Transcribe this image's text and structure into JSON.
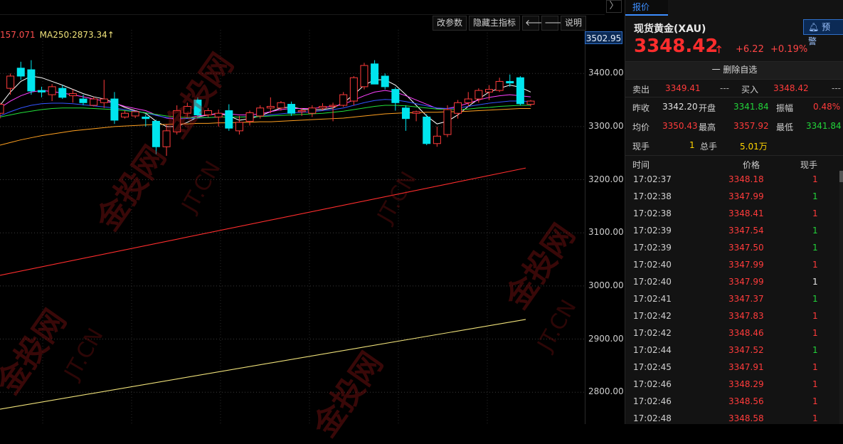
{
  "chart": {
    "toolbar": {
      "params_label": "改参数",
      "hide_indicator_label": "隐藏主指标",
      "prev_label": "🡐",
      "next_label": "🡒",
      "help_label": "说明"
    },
    "panel_toggle": "〉",
    "ma_legend": {
      "ma_partial": "157.071",
      "ma250": "MA250:2873.34↑"
    },
    "price_label_top": "3502.95",
    "y_ticks": [
      "3400.00",
      "3300.00",
      "3200.00",
      "3100.00",
      "3000.00",
      "2900.00",
      "2800.00"
    ],
    "watermark": {
      "brand": "金投网",
      "domain": "JT.CN"
    }
  },
  "chart_data": {
    "type": "candlestick",
    "ylim": [
      2740,
      3482
    ],
    "y_ticks": [
      3400,
      3300,
      3200,
      3100,
      3000,
      2900,
      2800
    ],
    "colors": {
      "up": "#ff3b3b",
      "down": "#00e5ee",
      "ma250": "#f0e27a",
      "ma_long": "#ff2d2d"
    },
    "candles": [
      {
        "o": 3325,
        "h": 3345,
        "l": 3315,
        "c": 3342
      },
      {
        "o": 3372,
        "h": 3400,
        "l": 3360,
        "c": 3395
      },
      {
        "o": 3410,
        "h": 3422,
        "l": 3388,
        "c": 3395
      },
      {
        "o": 3407,
        "h": 3425,
        "l": 3360,
        "c": 3367
      },
      {
        "o": 3368,
        "h": 3375,
        "l": 3355,
        "c": 3365
      },
      {
        "o": 3360,
        "h": 3380,
        "l": 3348,
        "c": 3375
      },
      {
        "o": 3372,
        "h": 3378,
        "l": 3352,
        "c": 3355
      },
      {
        "o": 3358,
        "h": 3370,
        "l": 3345,
        "c": 3362
      },
      {
        "o": 3352,
        "h": 3360,
        "l": 3340,
        "c": 3345
      },
      {
        "o": 3340,
        "h": 3356,
        "l": 3338,
        "c": 3352
      },
      {
        "o": 3345,
        "h": 3388,
        "l": 3335,
        "c": 3352
      },
      {
        "o": 3352,
        "h": 3365,
        "l": 3305,
        "c": 3312
      },
      {
        "o": 3318,
        "h": 3330,
        "l": 3315,
        "c": 3325
      },
      {
        "o": 3320,
        "h": 3330,
        "l": 3316,
        "c": 3328
      },
      {
        "o": 3318,
        "h": 3323,
        "l": 3300,
        "c": 3315
      },
      {
        "o": 3310,
        "h": 3313,
        "l": 3248,
        "c": 3262
      },
      {
        "o": 3262,
        "h": 3305,
        "l": 3245,
        "c": 3292
      },
      {
        "o": 3290,
        "h": 3340,
        "l": 3285,
        "c": 3330
      },
      {
        "o": 3325,
        "h": 3345,
        "l": 3318,
        "c": 3338
      },
      {
        "o": 3350,
        "h": 3355,
        "l": 3315,
        "c": 3322
      },
      {
        "o": 3322,
        "h": 3335,
        "l": 3318,
        "c": 3330
      },
      {
        "o": 3318,
        "h": 3332,
        "l": 3300,
        "c": 3325
      },
      {
        "o": 3330,
        "h": 3342,
        "l": 3292,
        "c": 3297
      },
      {
        "o": 3292,
        "h": 3320,
        "l": 3285,
        "c": 3308
      },
      {
        "o": 3310,
        "h": 3330,
        "l": 3302,
        "c": 3326
      },
      {
        "o": 3320,
        "h": 3340,
        "l": 3315,
        "c": 3335
      },
      {
        "o": 3335,
        "h": 3355,
        "l": 3325,
        "c": 3338
      },
      {
        "o": 3335,
        "h": 3348,
        "l": 3330,
        "c": 3345
      },
      {
        "o": 3342,
        "h": 3347,
        "l": 3320,
        "c": 3325
      },
      {
        "o": 3328,
        "h": 3335,
        "l": 3320,
        "c": 3330
      },
      {
        "o": 3325,
        "h": 3340,
        "l": 3318,
        "c": 3335
      },
      {
        "o": 3335,
        "h": 3344,
        "l": 3330,
        "c": 3338
      },
      {
        "o": 3338,
        "h": 3345,
        "l": 3310,
        "c": 3340
      },
      {
        "o": 3340,
        "h": 3365,
        "l": 3337,
        "c": 3360
      },
      {
        "o": 3348,
        "h": 3395,
        "l": 3340,
        "c": 3392
      },
      {
        "o": 3375,
        "h": 3420,
        "l": 3370,
        "c": 3415
      },
      {
        "o": 3418,
        "h": 3425,
        "l": 3395,
        "c": 3380
      },
      {
        "o": 3395,
        "h": 3400,
        "l": 3370,
        "c": 3375
      },
      {
        "o": 3370,
        "h": 3374,
        "l": 3330,
        "c": 3345
      },
      {
        "o": 3335,
        "h": 3340,
        "l": 3292,
        "c": 3315
      },
      {
        "o": 3325,
        "h": 3330,
        "l": 3310,
        "c": 3328
      },
      {
        "o": 3318,
        "h": 3323,
        "l": 3265,
        "c": 3268
      },
      {
        "o": 3268,
        "h": 3300,
        "l": 3262,
        "c": 3282
      },
      {
        "o": 3285,
        "h": 3340,
        "l": 3280,
        "c": 3332
      },
      {
        "o": 3325,
        "h": 3350,
        "l": 3315,
        "c": 3345
      },
      {
        "o": 3345,
        "h": 3365,
        "l": 3338,
        "c": 3352
      },
      {
        "o": 3352,
        "h": 3372,
        "l": 3345,
        "c": 3368
      },
      {
        "o": 3365,
        "h": 3378,
        "l": 3350,
        "c": 3370
      },
      {
        "o": 3368,
        "h": 3392,
        "l": 3365,
        "c": 3385
      },
      {
        "o": 3385,
        "h": 3398,
        "l": 3375,
        "c": 3382
      },
      {
        "o": 3392,
        "h": 3395,
        "l": 3340,
        "c": 3343
      },
      {
        "o": 3342,
        "h": 3350,
        "l": 3338,
        "c": 3348
      }
    ],
    "ma_lines": [
      {
        "color": "#ffffff",
        "values": [
          3340,
          3365,
          3385,
          3395,
          3392,
          3385,
          3378,
          3370,
          3362,
          3356,
          3352,
          3345,
          3336,
          3330,
          3325,
          3310,
          3300,
          3300,
          3308,
          3318,
          3322,
          3325,
          3320,
          3312,
          3315,
          3320,
          3328,
          3335,
          3337,
          3333,
          3331,
          3332,
          3335,
          3345,
          3360,
          3378,
          3388,
          3388,
          3378,
          3360,
          3340,
          3320,
          3305,
          3310,
          3322,
          3338,
          3352,
          3365,
          3372,
          3378,
          3374,
          3365
        ]
      },
      {
        "color": "#ff40ff",
        "values": [
          3335,
          3348,
          3358,
          3365,
          3368,
          3366,
          3363,
          3360,
          3356,
          3352,
          3348,
          3344,
          3338,
          3334,
          3330,
          3322,
          3316,
          3314,
          3316,
          3320,
          3322,
          3324,
          3324,
          3322,
          3322,
          3324,
          3328,
          3332,
          3334,
          3334,
          3334,
          3336,
          3338,
          3342,
          3350,
          3358,
          3365,
          3368,
          3365,
          3358,
          3350,
          3342,
          3334,
          3334,
          3338,
          3344,
          3350,
          3355,
          3358,
          3360,
          3358,
          3356
        ]
      },
      {
        "color": "#3355ff",
        "values": [
          3320,
          3328,
          3335,
          3340,
          3343,
          3344,
          3344,
          3343,
          3341,
          3339,
          3337,
          3335,
          3332,
          3329,
          3326,
          3321,
          3317,
          3315,
          3315,
          3316,
          3317,
          3318,
          3318,
          3318,
          3319,
          3320,
          3322,
          3324,
          3326,
          3327,
          3328,
          3330,
          3332,
          3335,
          3340,
          3345,
          3349,
          3351,
          3350,
          3347,
          3343,
          3339,
          3335,
          3334,
          3335,
          3338,
          3341,
          3344,
          3346,
          3348,
          3348,
          3347
        ]
      },
      {
        "color": "#22e03a",
        "values": [
          3318,
          3322,
          3326,
          3329,
          3332,
          3334,
          3335,
          3335,
          3335,
          3334,
          3333,
          3332,
          3330,
          3328,
          3326,
          3323,
          3320,
          3318,
          3317,
          3317,
          3317,
          3318,
          3318,
          3318,
          3318,
          3319,
          3320,
          3321,
          3322,
          3323,
          3324,
          3325,
          3327,
          3329,
          3332,
          3335,
          3338,
          3340,
          3340,
          3339,
          3337,
          3335,
          3333,
          3332,
          3332,
          3333,
          3335,
          3336,
          3338,
          3339,
          3340,
          3340
        ]
      },
      {
        "color": "#ffa020",
        "values": [
          3265,
          3270,
          3275,
          3279,
          3283,
          3286,
          3289,
          3292,
          3294,
          3296,
          3298,
          3300,
          3301,
          3302,
          3303,
          3304,
          3304,
          3305,
          3305,
          3306,
          3306,
          3307,
          3307,
          3308,
          3308,
          3309,
          3309,
          3310,
          3311,
          3312,
          3313,
          3314,
          3315,
          3316,
          3318,
          3320,
          3322,
          3324,
          3325,
          3326,
          3326,
          3327,
          3327,
          3328,
          3328,
          3329,
          3330,
          3331,
          3332,
          3333,
          3334,
          3334
        ]
      }
    ],
    "trend_lines": [
      {
        "color": "#ff2d2d",
        "from": [
          0,
          3020
        ],
        "to": [
          51,
          3222
        ]
      },
      {
        "color": "#f0e27a",
        "from": [
          0,
          2768
        ],
        "to": [
          51,
          2937
        ]
      }
    ]
  },
  "quote": {
    "tab_label": "报价",
    "symbol": "现货黄金(XAU)",
    "alert_label": "预警",
    "last_price": "3348.42",
    "arrow": "🡑",
    "change_abs": "+6.22",
    "change_pct": "+0.19%",
    "watchlist_label": "一  删除自选",
    "sell_label": "卖出",
    "sell_price": "3349.41",
    "sell_vol": "---",
    "buy_label": "买入",
    "buy_price": "3348.42",
    "buy_vol": "---",
    "prev_close_label": "昨收",
    "prev_close": "3342.20",
    "open_label": "开盘",
    "open": "3341.84",
    "amp_label": "振幅",
    "amp": "0.48%",
    "avg_label": "均价",
    "avg": "3350.43",
    "high_label": "最高",
    "high": "3357.92",
    "low_label": "最低",
    "low": "3341.84",
    "cur_vol_label": "现手",
    "cur_vol": "1",
    "total_vol_label": "总手",
    "total_vol": "5.01万",
    "ticks_header": {
      "time": "时间",
      "price": "价格",
      "vol": "现手"
    },
    "ticks": [
      {
        "time": "17:02:37",
        "price": "3348.18",
        "vol": "1",
        "color": "red"
      },
      {
        "time": "17:02:38",
        "price": "3347.99",
        "vol": "1",
        "color": "green"
      },
      {
        "time": "17:02:38",
        "price": "3348.41",
        "vol": "1",
        "color": "red"
      },
      {
        "time": "17:02:39",
        "price": "3347.54",
        "vol": "1",
        "color": "green"
      },
      {
        "time": "17:02:39",
        "price": "3347.50",
        "vol": "1",
        "color": "green"
      },
      {
        "time": "17:02:40",
        "price": "3347.99",
        "vol": "1",
        "color": "red"
      },
      {
        "time": "17:02:40",
        "price": "3347.99",
        "vol": "1",
        "color": "white"
      },
      {
        "time": "17:02:41",
        "price": "3347.37",
        "vol": "1",
        "color": "green"
      },
      {
        "time": "17:02:42",
        "price": "3347.83",
        "vol": "1",
        "color": "red"
      },
      {
        "time": "17:02:42",
        "price": "3348.46",
        "vol": "1",
        "color": "red"
      },
      {
        "time": "17:02:44",
        "price": "3347.52",
        "vol": "1",
        "color": "green"
      },
      {
        "time": "17:02:45",
        "price": "3347.91",
        "vol": "1",
        "color": "red"
      },
      {
        "time": "17:02:46",
        "price": "3348.29",
        "vol": "1",
        "color": "red"
      },
      {
        "time": "17:02:46",
        "price": "3348.56",
        "vol": "1",
        "color": "red"
      },
      {
        "time": "17:02:48",
        "price": "3348.58",
        "vol": "1",
        "color": "red"
      }
    ]
  }
}
